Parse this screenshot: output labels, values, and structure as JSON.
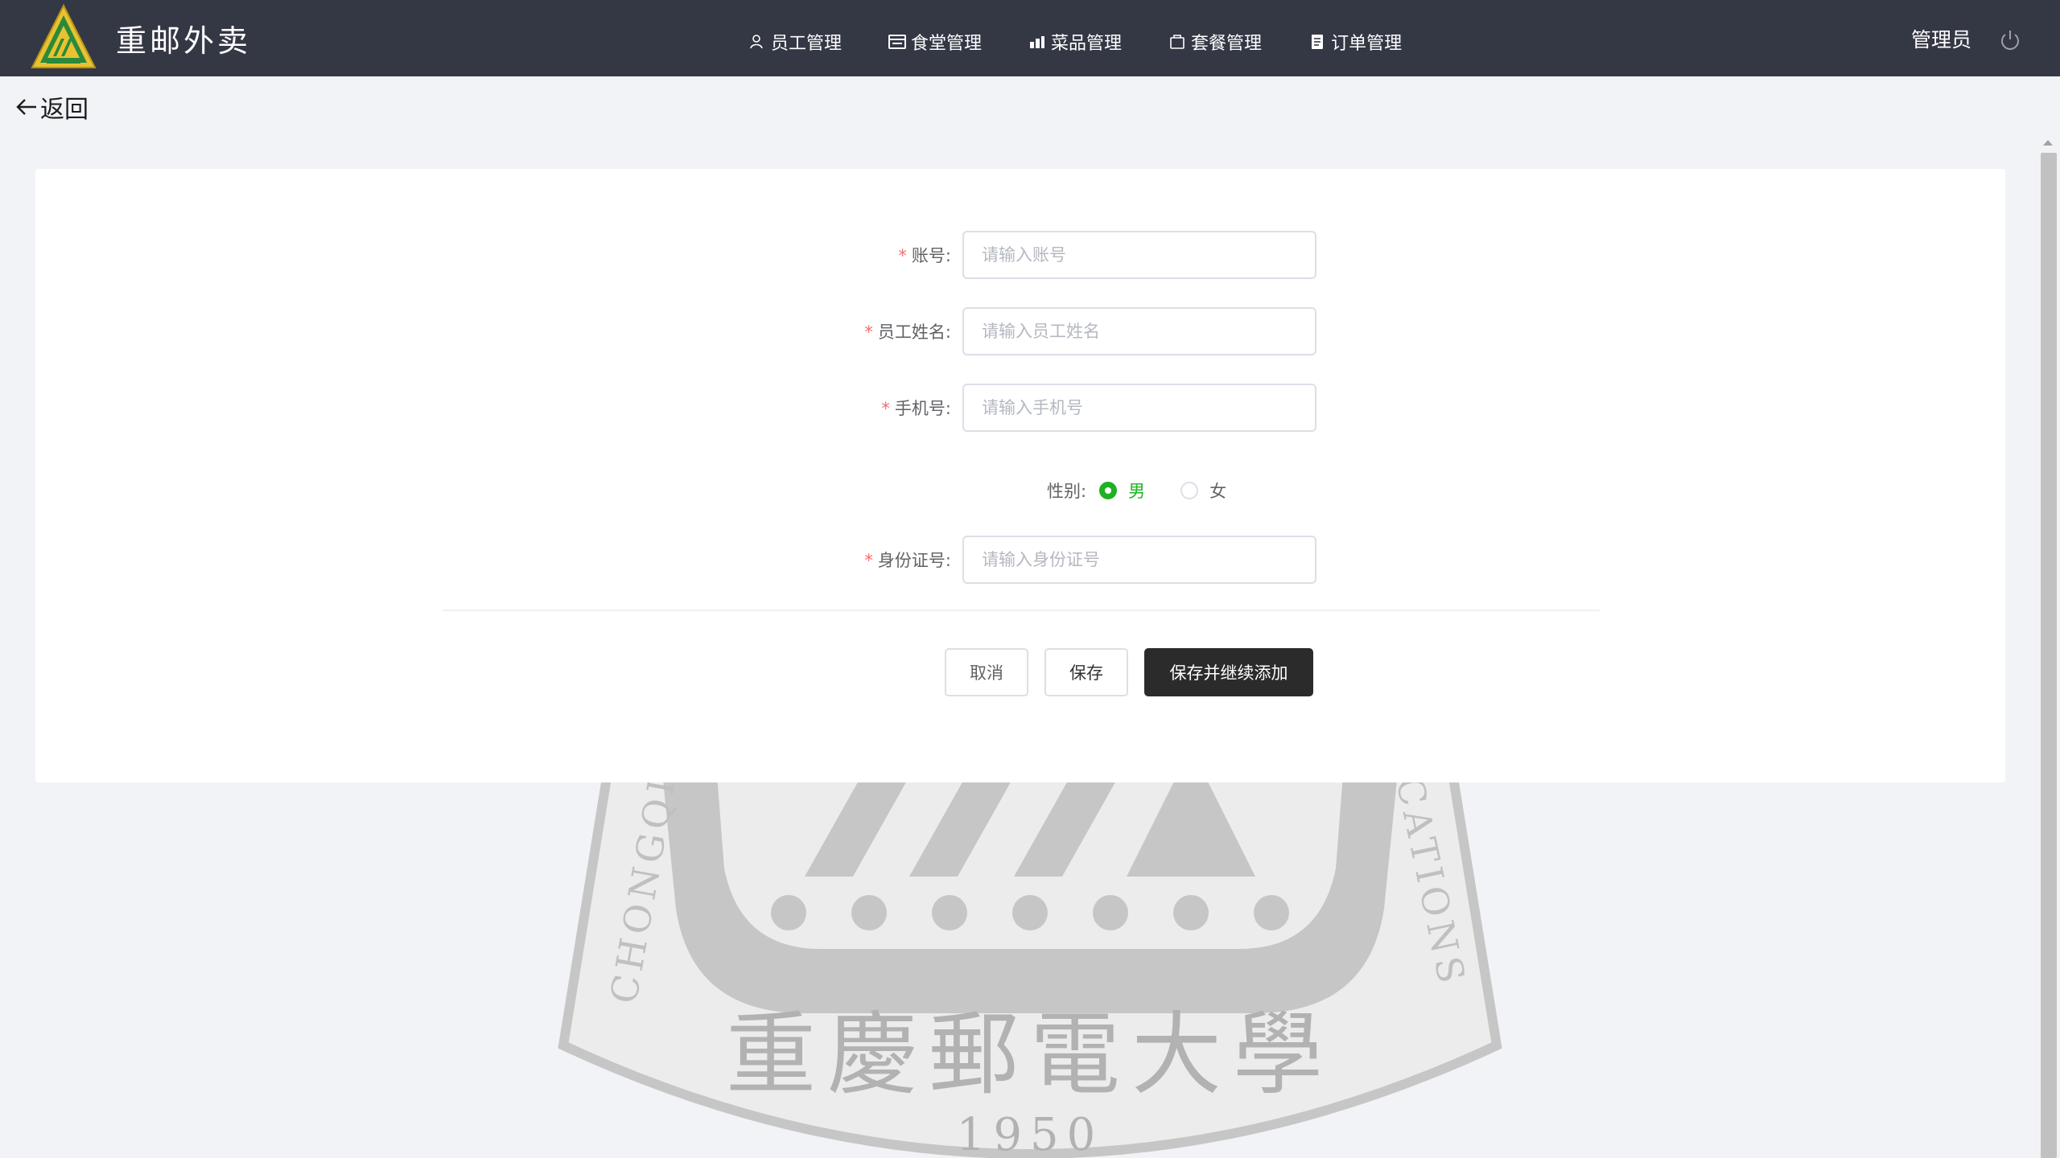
{
  "header": {
    "logo_icon": "cqupt-emblem-logo",
    "brand_name": "重邮外卖",
    "nav": [
      {
        "label": "员工管理",
        "icon": "user-icon"
      },
      {
        "label": "食堂管理",
        "icon": "canteen-icon"
      },
      {
        "label": "菜品管理",
        "icon": "dish-icon"
      },
      {
        "label": "套餐管理",
        "icon": "package-icon"
      },
      {
        "label": "订单管理",
        "icon": "order-icon"
      }
    ],
    "admin_label": "管理员",
    "power_icon": "power-icon"
  },
  "back": {
    "label": "返回",
    "icon": "arrow-left-icon"
  },
  "form": {
    "account": {
      "label": "账号:",
      "placeholder": "请输入账号",
      "required_mark": "*"
    },
    "name": {
      "label": "员工姓名:",
      "placeholder": "请输入员工姓名",
      "required_mark": "*"
    },
    "phone": {
      "label": "手机号:",
      "placeholder": "请输入手机号",
      "required_mark": "*"
    },
    "gender": {
      "label": "性别:",
      "options": [
        {
          "label": "男",
          "checked": true
        },
        {
          "label": "女",
          "checked": false
        }
      ]
    },
    "id_number": {
      "label": "身份证号:",
      "placeholder": "请输入身份证号",
      "required_mark": "*"
    }
  },
  "buttons": {
    "cancel": "取消",
    "save": "保存",
    "save_continue": "保存并继续添加"
  },
  "watermark": {
    "text_cn": "重慶郵電大學",
    "year": "1950",
    "text_left": "CHONGQIN",
    "text_right": "CATIONS"
  },
  "colors": {
    "header_bg": "#343744",
    "accent_green": "#1fb124",
    "required_red": "#f56c6c",
    "primary_button": "#2b2b2b"
  }
}
